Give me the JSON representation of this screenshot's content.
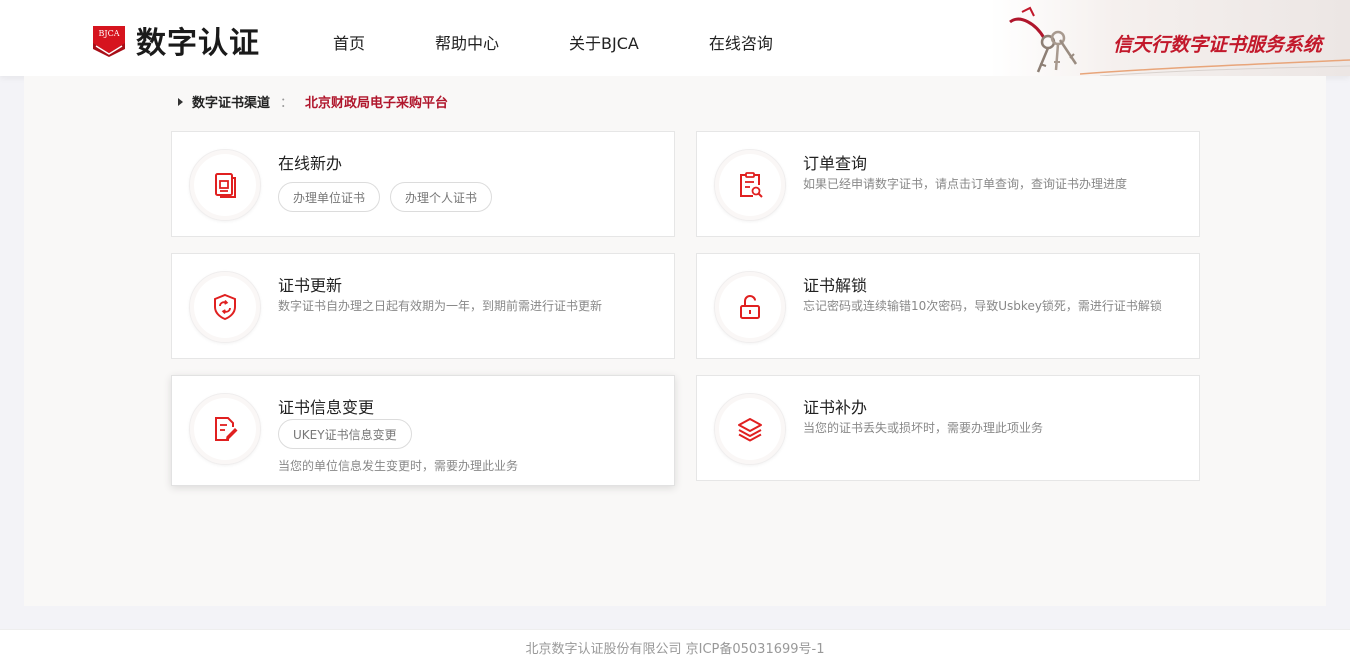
{
  "header": {
    "logo_badge": "BJCA",
    "logo_text": "数字认证",
    "slogan": "信天行数字证书服务系统",
    "nav": [
      {
        "label": "首页"
      },
      {
        "label": "帮助中心"
      },
      {
        "label": "关于BJCA"
      },
      {
        "label": "在线咨询"
      }
    ]
  },
  "breadcrumb": {
    "label": "数字证书渠道",
    "separator": "：",
    "value": "北京财政局电子采购平台"
  },
  "cards": [
    {
      "title": "在线新办",
      "icon": "document-seal-icon",
      "chips": [
        "办理单位证书",
        "办理个人证书"
      ]
    },
    {
      "title": "订单查询",
      "icon": "order-search-icon",
      "desc": "如果已经申请数字证书，请点击订单查询，查询证书办理进度"
    },
    {
      "title": "证书更新",
      "icon": "shield-refresh-icon",
      "desc": "数字证书自办理之日起有效期为一年，到期前需进行证书更新"
    },
    {
      "title": "证书解锁",
      "icon": "unlock-icon",
      "desc": "忘记密码或连续输错10次密码，导致Usbkey锁死，需进行证书解锁"
    },
    {
      "title": "证书信息变更",
      "icon": "edit-document-icon",
      "chips": [
        "UKEY证书信息变更"
      ],
      "desc": "当您的单位信息发生变更时，需要办理此业务"
    },
    {
      "title": "证书补办",
      "icon": "layers-icon",
      "desc": "当您的证书丢失或损坏时，需要办理此项业务"
    }
  ],
  "footer": {
    "text": "北京数字认证股份有限公司 京ICP备05031699号-1"
  },
  "colors": {
    "accent": "#e02020",
    "brand": "#b0162c",
    "slogan": "#c2182b"
  }
}
